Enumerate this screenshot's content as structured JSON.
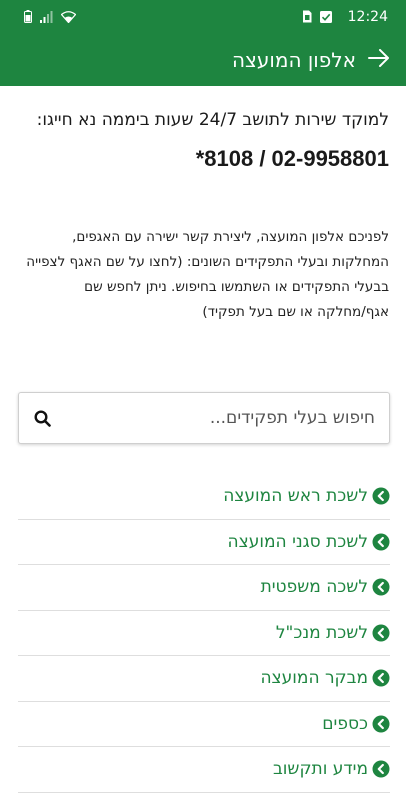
{
  "status_bar": {
    "time": "12:24",
    "icons": [
      "battery-icon",
      "signal-icon",
      "wifi-icon",
      "sim-icon",
      "check-icon"
    ]
  },
  "app_bar": {
    "title": "אלפון המועצה",
    "back_icon": "arrow-back-icon",
    "background": "#1e8540"
  },
  "hotline": {
    "text": "למוקד שירות לתושב 24/7 שעות ביממה נא חייגו:",
    "number": "*8108 / 02-9958801"
  },
  "intro": {
    "text": "לפניכם אלפון המועצה, ליצירת קשר ישירה עם האגפים, המחלקות ובעלי התפקידים השונים: (לחצו על שם האגף לצפייה בבעלי התפקידים או השתמשו בחיפוש. ניתן לחפש שם אגף/מחלקה או שם בעל תפקיד)"
  },
  "search": {
    "placeholder": "חיפוש בעלי תפקידים...",
    "value": ""
  },
  "departments": [
    {
      "label": "לשכת ראש המועצה"
    },
    {
      "label": "לשכת סגני המועצה"
    },
    {
      "label": "לשכה משפטית"
    },
    {
      "label": "לשכת מנכ\"ל"
    },
    {
      "label": "מבקר המועצה"
    },
    {
      "label": "כספים"
    },
    {
      "label": "מידע ותקשוב"
    }
  ],
  "colors": {
    "accent": "#1e8540",
    "divider": "#dedede"
  }
}
